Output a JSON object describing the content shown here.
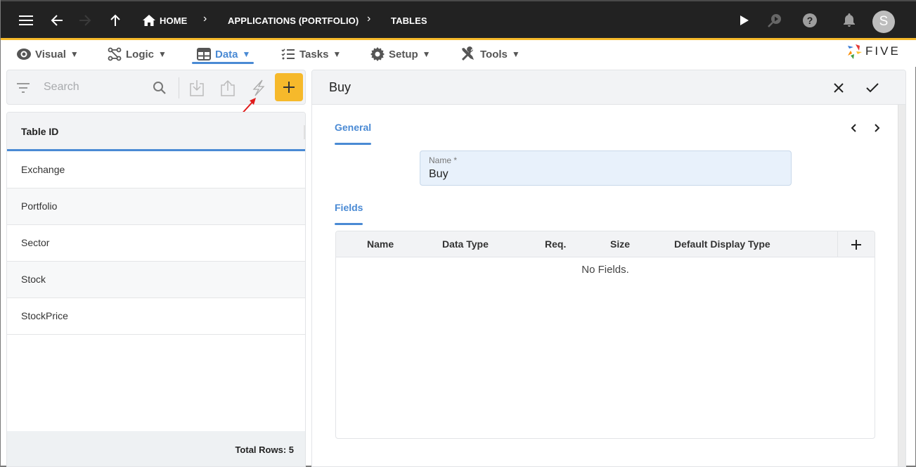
{
  "topbar": {
    "breadcrumbs": [
      {
        "label": "HOME",
        "icon": "home-icon"
      },
      {
        "label": "APPLICATIONS (PORTFOLIO)"
      },
      {
        "label": "TABLES"
      }
    ],
    "avatar_initial": "S",
    "accent_color": "#f6b92b"
  },
  "menubar": {
    "items": [
      {
        "label": "Visual",
        "icon": "eye-icon",
        "arrow": "▼"
      },
      {
        "label": "Logic",
        "icon": "logic-icon",
        "arrow": "▼"
      },
      {
        "label": "Data",
        "icon": "table-icon",
        "arrow": "▼",
        "active": true
      },
      {
        "label": "Tasks",
        "icon": "tasks-icon",
        "arrow": "▼"
      },
      {
        "label": "Setup",
        "icon": "gear-icon",
        "arrow": "▼"
      },
      {
        "label": "Tools",
        "icon": "tools-icon",
        "arrow": "▼"
      }
    ],
    "logo_text": "FIVE",
    "active_color": "#4a8ad4"
  },
  "list": {
    "search_placeholder": "Search",
    "column_header": "Table ID",
    "rows": [
      "Exchange",
      "Portfolio",
      "Sector",
      "Stock",
      "StockPrice"
    ],
    "footer": "Total Rows: 5"
  },
  "form": {
    "title": "Buy",
    "tabs": {
      "general": "General",
      "fields": "Fields"
    },
    "name_field": {
      "label": "Name *",
      "value": "Buy"
    },
    "fields_table": {
      "columns": [
        "Name",
        "Data Type",
        "Req.",
        "Size",
        "Default Display Type"
      ],
      "empty_message": "No Fields."
    }
  }
}
